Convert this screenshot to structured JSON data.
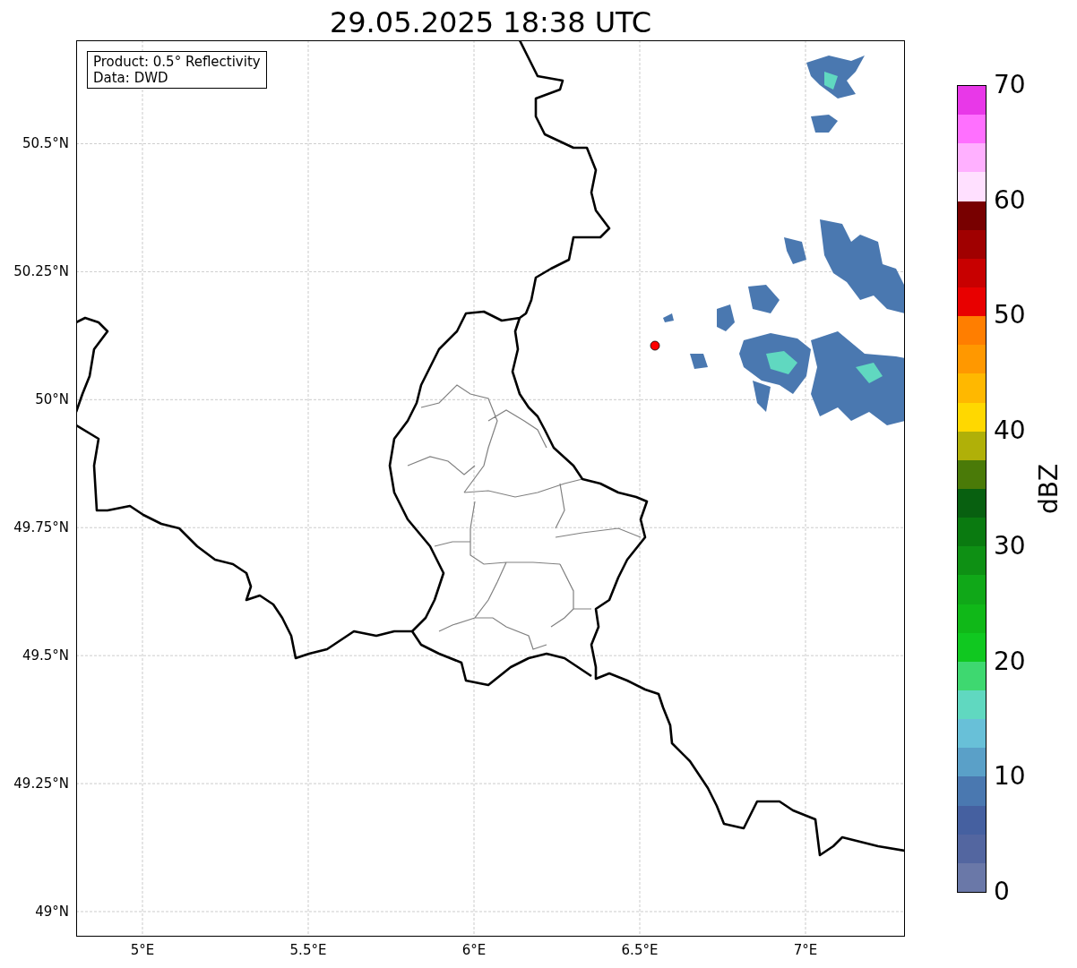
{
  "title": "29.05.2025 18:38 UTC",
  "info_box": [
    "Product: 0.5° Reflectivity",
    "Data: DWD"
  ],
  "map": {
    "xticks": [
      "5°E",
      "5.5°E",
      "6°E",
      "6.5°E",
      "7°E"
    ],
    "yticks": [
      "50.5°N",
      "50.25°N",
      "50°N",
      "49.75°N",
      "49.5°N",
      "49.25°N",
      "49°N"
    ]
  },
  "colorbar": {
    "label": "dBZ",
    "ticks": [
      "70",
      "60",
      "50",
      "40",
      "30",
      "20",
      "10",
      "0"
    ],
    "bins": [
      {
        "color": "#e838e8"
      },
      {
        "color": "#ff70ff"
      },
      {
        "color": "#ffb0ff"
      },
      {
        "color": "#ffe0ff"
      },
      {
        "color": "#780000"
      },
      {
        "color": "#a00000"
      },
      {
        "color": "#c80000"
      },
      {
        "color": "#e80000"
      },
      {
        "color": "#ff7e00"
      },
      {
        "color": "#ff9800"
      },
      {
        "color": "#ffb800"
      },
      {
        "color": "#ffd800"
      },
      {
        "color": "#b0b008"
      },
      {
        "color": "#4a7a08"
      },
      {
        "color": "#086010"
      },
      {
        "color": "#0a7a10"
      },
      {
        "color": "#0e9014"
      },
      {
        "color": "#10a818"
      },
      {
        "color": "#10b818"
      },
      {
        "color": "#10c820"
      },
      {
        "color": "#3ed870"
      },
      {
        "color": "#60d8c0"
      },
      {
        "color": "#68c0d8"
      },
      {
        "color": "#5aa0c8"
      },
      {
        "color": "#4a78b0"
      },
      {
        "color": "#4560a0"
      },
      {
        "color": "#5366a0"
      },
      {
        "color": "#6a78a8"
      }
    ]
  }
}
